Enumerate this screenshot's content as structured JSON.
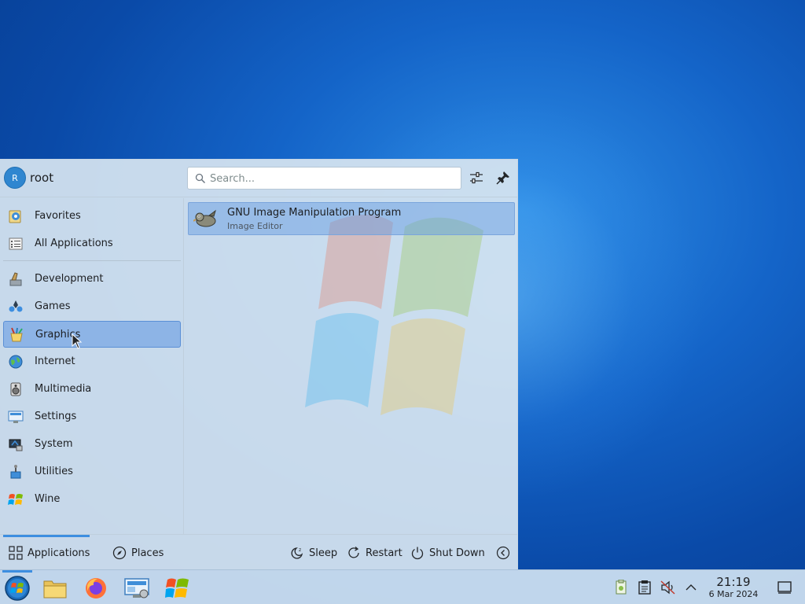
{
  "launcher": {
    "user": {
      "avatar_initial": "R",
      "name": "root"
    },
    "search": {
      "placeholder": "Search...",
      "value": ""
    },
    "header_icons": [
      "configure-icon",
      "pin-icon"
    ],
    "categories": [
      {
        "label": "Favorites",
        "icon": "favorites-icon"
      },
      {
        "label": "All Applications",
        "icon": "all-applications-icon"
      },
      {
        "label": "Development",
        "icon": "development-icon"
      },
      {
        "label": "Games",
        "icon": "games-icon"
      },
      {
        "label": "Graphics",
        "icon": "graphics-icon",
        "selected": true
      },
      {
        "label": "Internet",
        "icon": "internet-icon"
      },
      {
        "label": "Multimedia",
        "icon": "multimedia-icon"
      },
      {
        "label": "Settings",
        "icon": "settings-icon"
      },
      {
        "label": "System",
        "icon": "system-icon"
      },
      {
        "label": "Utilities",
        "icon": "utilities-icon"
      },
      {
        "label": "Wine",
        "icon": "wine-icon"
      }
    ],
    "apps": [
      {
        "name": "GNU Image Manipulation Program",
        "description": "Image Editor",
        "icon": "gimp-icon"
      }
    ],
    "footer": {
      "tabs": [
        {
          "label": "Applications",
          "icon": "grid-icon",
          "active": true
        },
        {
          "label": "Places",
          "icon": "compass-icon"
        }
      ],
      "power": [
        {
          "label": "Sleep",
          "icon": "sleep-icon"
        },
        {
          "label": "Restart",
          "icon": "restart-icon"
        },
        {
          "label": "Shut Down",
          "icon": "power-icon"
        }
      ],
      "more_icon": "chevron-left-icon"
    }
  },
  "taskbar": {
    "tasks": [
      "start-menu-icon",
      "file-manager-icon",
      "firefox-icon",
      "system-settings-icon",
      "windows-logo-icon"
    ],
    "tray": [
      "clipboard-cert-icon",
      "notes-icon",
      "volume-muted-icon",
      "chevron-up-icon"
    ],
    "clock": {
      "time": "21:19",
      "date": "6 Mar 2024"
    },
    "show_desktop_icon": "show-desktop-icon"
  }
}
